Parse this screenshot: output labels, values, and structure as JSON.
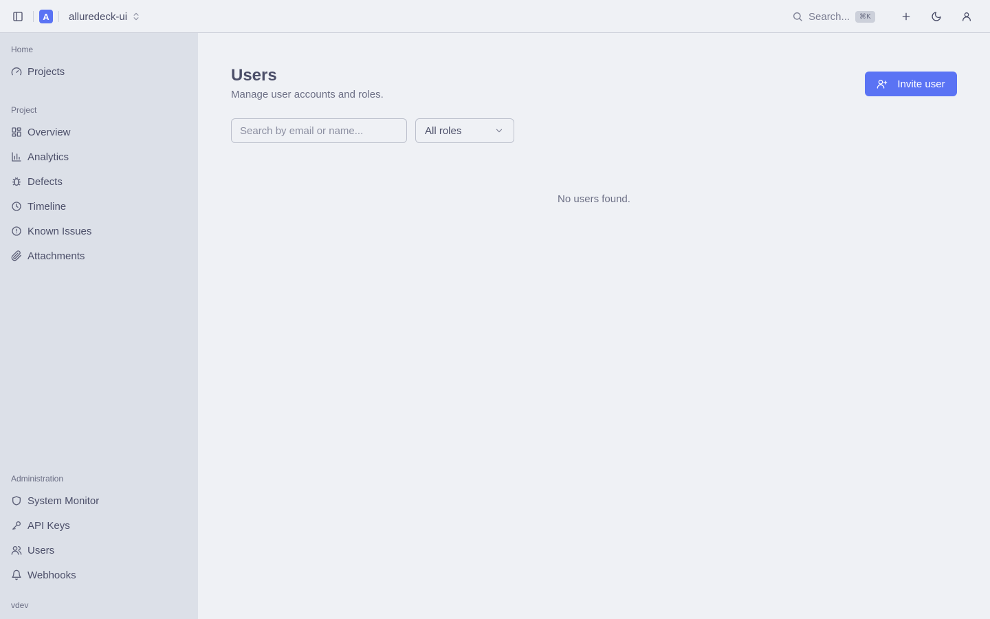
{
  "topbar": {
    "logo_letter": "A",
    "project_name": "alluredeck-ui",
    "search_label": "Search...",
    "search_shortcut": "⌘K"
  },
  "sidebar": {
    "sections": {
      "home": "Home",
      "project": "Project",
      "administration": "Administration"
    },
    "home_items": [
      {
        "label": "Projects",
        "icon": "gauge-icon"
      }
    ],
    "project_items": [
      {
        "label": "Overview",
        "icon": "grid-icon"
      },
      {
        "label": "Analytics",
        "icon": "bar-chart-icon"
      },
      {
        "label": "Defects",
        "icon": "bug-icon"
      },
      {
        "label": "Timeline",
        "icon": "clock-icon"
      },
      {
        "label": "Known Issues",
        "icon": "alert-circle-icon"
      },
      {
        "label": "Attachments",
        "icon": "paperclip-icon"
      }
    ],
    "admin_items": [
      {
        "label": "System Monitor",
        "icon": "shield-icon"
      },
      {
        "label": "API Keys",
        "icon": "key-icon"
      },
      {
        "label": "Users",
        "icon": "users-icon"
      },
      {
        "label": "Webhooks",
        "icon": "bell-icon"
      }
    ],
    "version": "vdev"
  },
  "main": {
    "title": "Users",
    "subtitle": "Manage user accounts and roles.",
    "invite_label": "Invite user",
    "search_placeholder": "Search by email or name...",
    "search_value": "",
    "role_filter": "All roles",
    "empty_message": "No users found."
  },
  "colors": {
    "accent": "#5a73f4",
    "background": "#eff1f5",
    "sidebar": "#dce0e8"
  }
}
